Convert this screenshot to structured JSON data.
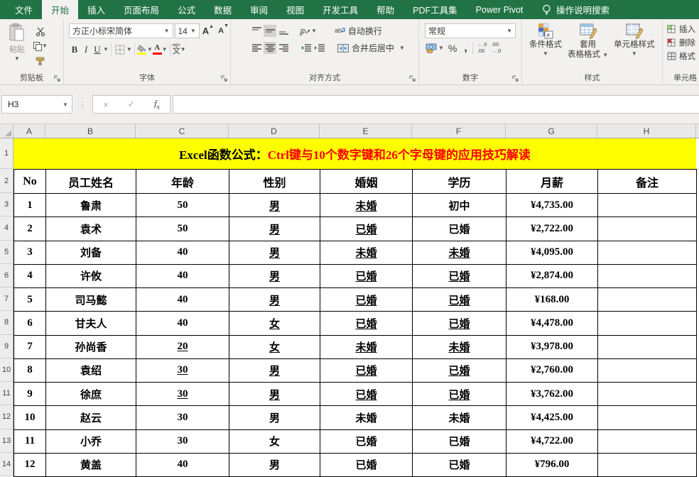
{
  "tab_bar": {
    "tabs": [
      {
        "label": "文件",
        "active": false
      },
      {
        "label": "开始",
        "active": true
      },
      {
        "label": "插入",
        "active": false
      },
      {
        "label": "页面布局",
        "active": false
      },
      {
        "label": "公式",
        "active": false
      },
      {
        "label": "数据",
        "active": false
      },
      {
        "label": "审阅",
        "active": false
      },
      {
        "label": "视图",
        "active": false
      },
      {
        "label": "开发工具",
        "active": false
      },
      {
        "label": "帮助",
        "active": false
      },
      {
        "label": "PDF工具集",
        "active": false
      },
      {
        "label": "Power Pivot",
        "active": false
      }
    ],
    "search_label": "操作说明搜索"
  },
  "ribbon": {
    "clipboard": {
      "group_label": "剪贴板",
      "paste_label": "粘贴"
    },
    "font": {
      "group_label": "字体",
      "font_name": "方正小标宋简体",
      "font_size": "14",
      "bold": "B",
      "italic": "I",
      "underline": "U",
      "phonetic_char": "文",
      "phonetic_pinyin": "wén"
    },
    "alignment": {
      "group_label": "对齐方式",
      "wrap_label": "自动换行",
      "merge_label": "合并后居中"
    },
    "number": {
      "group_label": "数字",
      "format_value": "常规",
      "percent": "%",
      "comma": "，",
      "inc_decimal": "←.0\n.00",
      "dec_decimal": ".00\n→.0"
    },
    "styles": {
      "group_label": "样式",
      "conditional_label": "条件格式",
      "table_style_line1": "套用",
      "table_style_line2": "表格格式",
      "cell_style_label": "单元格样式"
    },
    "cells": {
      "group_label": "单元格",
      "insert_label": "插入",
      "delete_label": "删除",
      "format_label": "格式"
    }
  },
  "formula_bar": {
    "name_box": "H3",
    "formula_value": ""
  },
  "sheet": {
    "column_letters": [
      "A",
      "B",
      "C",
      "D",
      "E",
      "F",
      "G",
      "H"
    ],
    "row_numbers": [
      "1",
      "2",
      "3",
      "4",
      "5",
      "6",
      "7",
      "8",
      "9",
      "10",
      "11",
      "12",
      "13",
      "14"
    ],
    "title": {
      "prefix": "Excel函数公式：",
      "main": "Ctrl键与10个数字键和26个字母键的应用技巧解读",
      "bg": "#FFFF00",
      "prefix_color": "#000000",
      "main_color": "#FF0000"
    },
    "header_row": [
      "No",
      "员工姓名",
      "年龄",
      "性别",
      "婚姻",
      "学历",
      "月薪",
      "备注"
    ],
    "rows": [
      {
        "no": "1",
        "name": "鲁肃",
        "age": "50",
        "gender": "男",
        "marital": "未婚",
        "education": "初中",
        "salary": "¥4,735.00",
        "remark": "",
        "underline": {
          "age": false,
          "gender": true,
          "marital": true,
          "education": false
        }
      },
      {
        "no": "2",
        "name": "袁术",
        "age": "50",
        "gender": "男",
        "marital": "已婚",
        "education": "已婚",
        "salary": "¥2,722.00",
        "remark": "",
        "underline": {
          "age": false,
          "gender": true,
          "marital": true,
          "education": false
        }
      },
      {
        "no": "3",
        "name": "刘备",
        "age": "40",
        "gender": "男",
        "marital": "未婚",
        "education": "未婚",
        "salary": "¥4,095.00",
        "remark": "",
        "underline": {
          "age": false,
          "gender": true,
          "marital": true,
          "education": true
        }
      },
      {
        "no": "4",
        "name": "许攸",
        "age": "40",
        "gender": "男",
        "marital": "已婚",
        "education": "已婚",
        "salary": "¥2,874.00",
        "remark": "",
        "underline": {
          "age": false,
          "gender": true,
          "marital": true,
          "education": true
        }
      },
      {
        "no": "5",
        "name": "司马懿",
        "age": "40",
        "gender": "男",
        "marital": "已婚",
        "education": "已婚",
        "salary": "¥168.00",
        "remark": "",
        "underline": {
          "age": false,
          "gender": true,
          "marital": true,
          "education": true
        }
      },
      {
        "no": "6",
        "name": "甘夫人",
        "age": "40",
        "gender": "女",
        "marital": "已婚",
        "education": "已婚",
        "salary": "¥4,478.00",
        "remark": "",
        "underline": {
          "age": false,
          "gender": true,
          "marital": true,
          "education": true
        }
      },
      {
        "no": "7",
        "name": "孙尚香",
        "age": "20",
        "gender": "女",
        "marital": "未婚",
        "education": "未婚",
        "salary": "¥3,978.00",
        "remark": "",
        "underline": {
          "age": true,
          "gender": true,
          "marital": true,
          "education": true
        }
      },
      {
        "no": "8",
        "name": "袁绍",
        "age": "30",
        "gender": "男",
        "marital": "已婚",
        "education": "已婚",
        "salary": "¥2,760.00",
        "remark": "",
        "underline": {
          "age": true,
          "gender": true,
          "marital": true,
          "education": true
        }
      },
      {
        "no": "9",
        "name": "徐庶",
        "age": "30",
        "gender": "男",
        "marital": "已婚",
        "education": "已婚",
        "salary": "¥3,762.00",
        "remark": "",
        "underline": {
          "age": true,
          "gender": true,
          "marital": true,
          "education": true
        }
      },
      {
        "no": "10",
        "name": "赵云",
        "age": "30",
        "gender": "男",
        "marital": "未婚",
        "education": "未婚",
        "salary": "¥4,425.00",
        "remark": "",
        "underline": {
          "age": false,
          "gender": false,
          "marital": false,
          "education": false
        }
      },
      {
        "no": "11",
        "name": "小乔",
        "age": "30",
        "gender": "女",
        "marital": "已婚",
        "education": "已婚",
        "salary": "¥4,722.00",
        "remark": "",
        "underline": {
          "age": false,
          "gender": false,
          "marital": false,
          "education": false
        }
      },
      {
        "no": "12",
        "name": "黄盖",
        "age": "40",
        "gender": "男",
        "marital": "已婚",
        "education": "已婚",
        "salary": "¥796.00",
        "remark": "",
        "underline": {
          "age": false,
          "gender": false,
          "marital": false,
          "education": false
        }
      }
    ]
  },
  "colors": {
    "excel_green": "#217346",
    "banner_yellow": "#FFFF00",
    "title_red": "#FF0000",
    "highlight_yellow": "#FFFF00",
    "font_color_red": "#FF0000"
  }
}
